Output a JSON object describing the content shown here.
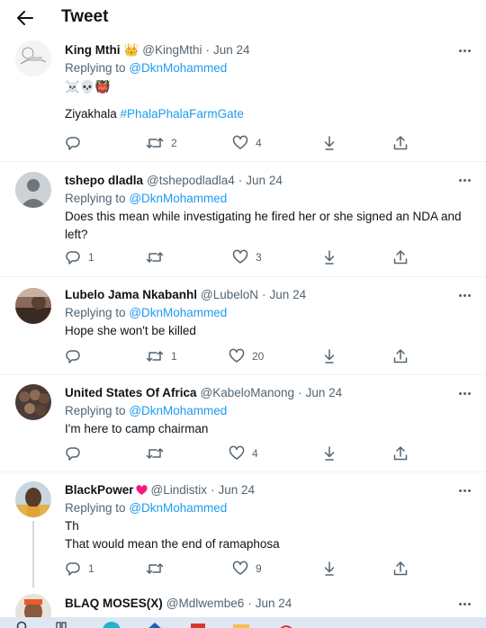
{
  "header": {
    "title": "Tweet",
    "back_icon": "arrow-left-icon"
  },
  "colors": {
    "accent": "#1d9bf0",
    "text": "#0f1419",
    "secondary": "#536471",
    "divider": "#eff3f4",
    "heart_badge": "#f91880"
  },
  "tweets": [
    {
      "name": "King Mthi",
      "name_badge": "👑",
      "handle": "@KingMthi",
      "separator": "·",
      "date": "Jun 24",
      "replying_prefix": "Replying to",
      "replying_to": "@DknMohammed",
      "emoji_line": "☠️💀👹",
      "text_before": "Ziyakhala",
      "hashtag": "#PhalaPhalaFarmGate",
      "reply_count": "",
      "retweet_count": "2",
      "like_count": "4"
    },
    {
      "name": "tshepo dladla",
      "handle": "@tshepodladla4",
      "separator": "·",
      "date": "Jun 24",
      "replying_prefix": "Replying to",
      "replying_to": "@DknMohammed",
      "text": "Does this mean while investigating he fired her or she signed an NDA and left?",
      "reply_count": "1",
      "retweet_count": "",
      "like_count": "3"
    },
    {
      "name": "Lubelo Jama Nkabanhl",
      "handle": "@LubeloN",
      "separator": "·",
      "date": "Jun 24",
      "replying_prefix": "Replying to",
      "replying_to": "@DknMohammed",
      "text": "Hope she won't be killed",
      "reply_count": "",
      "retweet_count": "1",
      "like_count": "20"
    },
    {
      "name": "United States Of Africa",
      "handle": "@KabeloManong",
      "separator": "·",
      "date": "Jun 24",
      "replying_prefix": "Replying to",
      "replying_to": "@DknMohammed",
      "text": "I'm here to camp chairman",
      "reply_count": "",
      "retweet_count": "",
      "like_count": "4"
    },
    {
      "name": "BlackPower",
      "handle": "@Lindistix",
      "separator": "·",
      "date": "Jun 24",
      "replying_prefix": "Replying to",
      "replying_to": "@DknMohammed",
      "text_line1": "Th",
      "text_line2": "That would mean the end of ramaphosa",
      "reply_count": "1",
      "retweet_count": "",
      "like_count": "9"
    },
    {
      "name": "BLAQ MOSES(X)",
      "handle": "@Mdlwembe6",
      "separator": "·",
      "date": "Jun 24"
    }
  ]
}
